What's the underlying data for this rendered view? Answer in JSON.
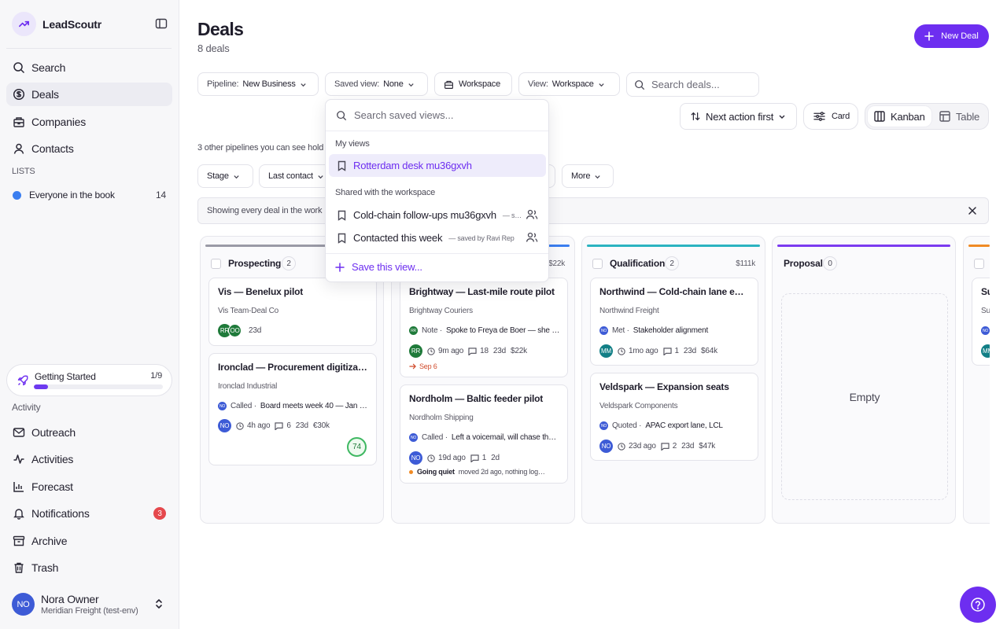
{
  "app": {
    "name": "LeadScoutr"
  },
  "sidebar": {
    "nav": [
      {
        "label": "Search",
        "icon": "search-icon"
      },
      {
        "label": "Deals",
        "icon": "deals-icon",
        "active": true
      },
      {
        "label": "Companies",
        "icon": "building-icon"
      },
      {
        "label": "Contacts",
        "icon": "user-icon"
      }
    ],
    "lists_label": "LISTS",
    "lists": [
      {
        "label": "Everyone in the book",
        "count": "14",
        "color": "#3b7ef0"
      }
    ],
    "getting_started": {
      "label": "Getting Started",
      "count": "1/9",
      "progress": 0.11
    },
    "activity_label": "Activity",
    "activity_nav": [
      {
        "label": "Outreach",
        "icon": "mail-icon"
      },
      {
        "label": "Activities",
        "icon": "activity-icon"
      },
      {
        "label": "Forecast",
        "icon": "chart-icon"
      },
      {
        "label": "Notifications",
        "icon": "bell-icon",
        "badge": "3"
      },
      {
        "label": "Archive",
        "icon": "archive-icon"
      },
      {
        "label": "Trash",
        "icon": "trash-icon"
      }
    ],
    "user": {
      "initials": "NO",
      "name": "Nora Owner",
      "org": "Meridian Freight (test-env)"
    }
  },
  "header": {
    "title": "Deals",
    "subtitle": "8 deals",
    "new_deal_label": "New Deal"
  },
  "filters": {
    "pipeline": {
      "label": "Pipeline:",
      "value": "New Business"
    },
    "saved_view": {
      "label": "Saved view:",
      "value": "None"
    },
    "workspace_label": "Workspace",
    "view": {
      "label": "View:",
      "value": "Workspace"
    },
    "search_placeholder": "Search deals...",
    "sort_label": "Next action first",
    "card_label": "Card",
    "kanban_label": "Kanban",
    "table_label": "Table",
    "other_pipelines": "3 other pipelines you can see hold",
    "stage_label": "Stage",
    "last_contact_label": "Last contact",
    "more_label": "More",
    "banner_text": "Showing every deal in the work"
  },
  "columns": [
    {
      "title": "Prospecting",
      "count": "2",
      "total": "",
      "color": "#9a9aa6"
    },
    {
      "title": "",
      "count": "",
      "total": "$22k",
      "color": "#3b7ef0"
    },
    {
      "title": "Qualification",
      "count": "2",
      "total": "$111k",
      "color": "#2bb3c0"
    },
    {
      "title": "Proposal",
      "count": "0",
      "total": "",
      "color": "#7b3af0",
      "empty": "Empty"
    },
    {
      "title": "",
      "count": "",
      "total": "",
      "color": "#f08a24"
    }
  ],
  "deals": {
    "vis": {
      "title": "Vis — Benelux pilot",
      "company": "Vis Team-Deal Co",
      "av1": "RR",
      "av2": "OO",
      "age": "23d"
    },
    "ironclad": {
      "title": "Ironclad — Procurement digitization",
      "company": "Ironclad Industrial",
      "note_av": "NO",
      "note_type": "Called ·",
      "note_text": "Board meets week 40 — Jan …",
      "av": "NO",
      "time": "4h ago",
      "comments": "6",
      "age": "23d",
      "value": "€30k",
      "score": "74"
    },
    "brightway": {
      "title": "Brightway — Last-mile route pilot",
      "company": "Brightway Couriers",
      "note_av": "RR",
      "note_type": "Note ·",
      "note_text": "Spoke to Freya de Boer — she …",
      "av": "RR",
      "time": "9m ago",
      "comments": "18",
      "age": "23d",
      "value": "$22k",
      "follow": "Sep 6"
    },
    "nordholm": {
      "title": "Nordholm — Baltic feeder pilot",
      "company": "Nordholm Shipping",
      "note_av": "NO",
      "note_type": "Called ·",
      "note_text": "Left a voicemail, will chase th…",
      "av": "NO",
      "time": "19d ago",
      "comments": "1",
      "age": "2d",
      "quiet_label": "Going quiet",
      "quiet_text": "moved 2d ago, nothing log…"
    },
    "northwind": {
      "title": "Northwind — Cold-chain lane expa…",
      "company": "Northwind Freight",
      "note_av": "NO",
      "note_type": "Met ·",
      "note_text": "Stakeholder alignment",
      "av": "MM",
      "time": "1mo ago",
      "comments": "1",
      "age": "23d",
      "value": "$64k"
    },
    "veldspark": {
      "title": "Veldspark — Expansion seats",
      "company": "Veldspark Components",
      "note_av": "NO",
      "note_type": "Quoted ·",
      "note_text": "APAC export lane, LCL",
      "av": "NO",
      "time": "23d ago",
      "comments": "2",
      "age": "23d",
      "value": "$47k"
    },
    "partial": {
      "title": "Su",
      "company": "Su",
      "note_av": "NO",
      "av": "MM"
    }
  },
  "dropdown": {
    "search_placeholder": "Search saved views...",
    "my_views_label": "My views",
    "my_views": [
      {
        "label": "Rotterdam desk mu36gxvh"
      }
    ],
    "shared_label": "Shared with the workspace",
    "shared": [
      {
        "label": "Cold-chain follow-ups mu36gxvh",
        "by": "— s…"
      },
      {
        "label": "Contacted this week",
        "by": "— saved by Ravi Rep"
      }
    ],
    "save_label": "Save this view..."
  },
  "colors": {
    "accent": "#6d2ef0",
    "danger": "#e5484d"
  }
}
